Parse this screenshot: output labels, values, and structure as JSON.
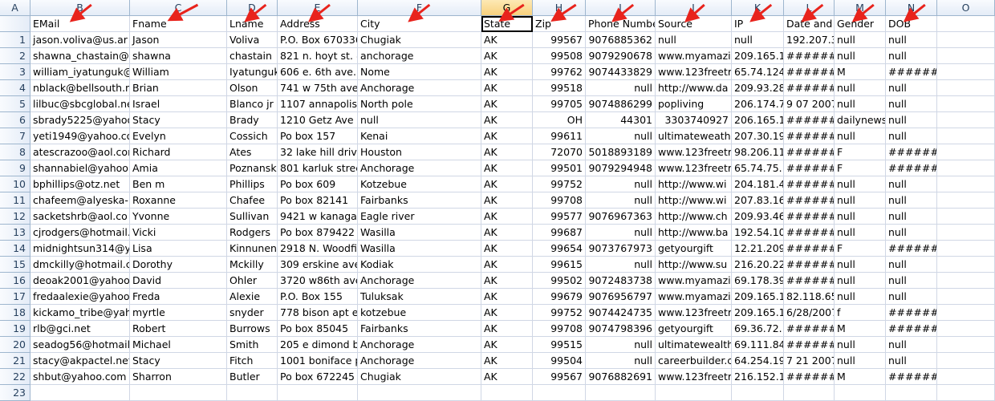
{
  "columns": [
    "A",
    "B",
    "C",
    "D",
    "E",
    "F",
    "G",
    "H",
    "I",
    "J",
    "K",
    "L",
    "M",
    "N",
    "O"
  ],
  "selected_column": "G",
  "accent_color": "#e8231c",
  "rows": [
    [
      "",
      "EMail",
      "Fname",
      "Lname",
      "Address",
      "City",
      "State",
      "Zip",
      "Phone Numbe",
      "Source",
      "IP",
      "Date and",
      "Gender",
      "DOB",
      ""
    ],
    [
      "1",
      "jason.voliva@us.ar",
      "Jason",
      "Voliva",
      "P.O. Box 670336",
      "Chugiak",
      "AK",
      "99567",
      "9076885362",
      "null",
      "null",
      "192.207.30",
      "null",
      "null",
      ""
    ],
    [
      "2",
      "shawna_chastain@",
      "shawna",
      "chastain",
      "821 n. hoyt st. #",
      "anchorage",
      "AK",
      "99508",
      "9079290678",
      "www.myamazi",
      "209.165.17",
      "########",
      "null",
      "null",
      ""
    ],
    [
      "3",
      "william_iyatunguk@",
      "William",
      "Iyatunguk",
      "606 e. 6th ave.",
      "Nome",
      "AK",
      "99762",
      "9074433829",
      "www.123freetr",
      "65.74.124.",
      "########",
      "M",
      "########",
      ""
    ],
    [
      "4",
      "nblack@bellsouth.n",
      "Brian",
      "Olson",
      "741 w 75th ave a",
      "Anchorage",
      "AK",
      "99518",
      "null",
      "http://www.da",
      "209.93.28.",
      "########",
      "null",
      "null",
      ""
    ],
    [
      "5",
      "lilbuc@sbcglobal.ne",
      "Israel",
      "Blanco jr",
      "1107 annapolis",
      "North pole",
      "AK",
      "99705",
      "9074886299",
      "popliving",
      "206.174.7.",
      "9 07 2007 :",
      "null",
      "null",
      ""
    ],
    [
      "6",
      "sbrady5225@yahoo",
      "Stacy",
      "Brady",
      "1210 Getz Ave",
      "null",
      "AK",
      "OH",
      "44301",
      "3303740927",
      "206.165.11",
      "########",
      "dailynews",
      "null",
      ""
    ],
    [
      "7",
      "yeti1949@yahoo.co",
      "Evelyn",
      "Cossich",
      "Po box 157",
      "Kenai",
      "AK",
      "99611",
      "null",
      "ultimateweath",
      "207.30.196",
      "########",
      "null",
      "null",
      ""
    ],
    [
      "8",
      "atescrazoo@aol.cor",
      "Richard",
      "Ates",
      "32 lake hill drive",
      "Houston",
      "AK",
      "72070",
      "5018893189",
      "www.123freetr",
      "98.206.113",
      "########",
      "F",
      "########",
      ""
    ],
    [
      "9",
      "shannabiel@yahoo",
      "Amia",
      "Poznanski",
      "801 karluk stree",
      "Anchorage",
      "AK",
      "99501",
      "9079294948",
      "www.123freetr",
      "65.74.75.1",
      "########",
      "F",
      "########",
      ""
    ],
    [
      "10",
      "bphillips@otz.net",
      "Ben m",
      "Phillips",
      "Po box 609",
      "Kotzebue",
      "AK",
      "99752",
      "null",
      "http://www.wi",
      "204.181.43",
      "########",
      "null",
      "null",
      ""
    ],
    [
      "11",
      "chafeem@alyeska-p",
      "Roxanne",
      "Chafee",
      "Po box 82141",
      "Fairbanks",
      "AK",
      "99708",
      "null",
      "http://www.wi",
      "207.83.16.",
      "########",
      "null",
      "null",
      ""
    ],
    [
      "12",
      "sacketshrb@aol.co",
      "Yvonne",
      "Sullivan",
      "9421 w kanaga l",
      "Eagle river",
      "AK",
      "99577",
      "9076967363",
      "http://www.ch",
      "209.93.46.",
      "########",
      "null",
      "null",
      ""
    ],
    [
      "13",
      "cjrodgers@hotmail.",
      "Vicki",
      "Rodgers",
      "Po box 879422",
      "Wasilla",
      "AK",
      "99687",
      "null",
      "http://www.ba",
      "192.54.109",
      "########",
      "null",
      "null",
      ""
    ],
    [
      "14",
      "midnightsun314@y",
      "Lisa",
      "Kinnunen",
      "2918 N. Woodfie",
      "Wasilla",
      "AK",
      "99654",
      "9073767973",
      "getyourgift",
      "12.21.209.",
      "########",
      "F",
      "########",
      ""
    ],
    [
      "15",
      "dmckilly@hotmail.c",
      "Dorothy",
      "Mckilly",
      "309 erskine ave",
      "Kodiak",
      "AK",
      "99615",
      "null",
      "http://www.su",
      "216.20.221",
      "########",
      "null",
      "null",
      ""
    ],
    [
      "16",
      "deoak2001@yahoo.",
      "David",
      "Ohler",
      "3720 w86th ave",
      "Anchorage",
      "AK",
      "99502",
      "9072483738",
      "www.myamazi",
      "69.178.39.",
      "########",
      "null",
      "null",
      ""
    ],
    [
      "17",
      "fredaalexie@yahoo",
      "Freda",
      "Alexie",
      "P.O. Box 155",
      "Tuluksak",
      "AK",
      "99679",
      "9076956797",
      "www.myamazi",
      "209.165.13",
      "82.118.65.",
      "null",
      "null",
      ""
    ],
    [
      "18",
      "kickamo_tribe@yah",
      "myrtle",
      "snyder",
      "778 bison apt e2",
      "kotzebue",
      "AK",
      "99752",
      "9074424735",
      "www.123freetr",
      "209.165.14",
      "6/28/2007",
      "f",
      "########",
      ""
    ],
    [
      "19",
      "rlb@gci.net",
      "Robert",
      "Burrows",
      "Po box 85045",
      "Fairbanks",
      "AK",
      "99708",
      "9074798396",
      "getyourgift",
      "69.36.72.1",
      "########",
      "M",
      "########",
      ""
    ],
    [
      "20",
      "seadog56@hotmail",
      "Michael",
      "Smith",
      "205 e dimond bl",
      "Anchorage",
      "AK",
      "99515",
      "null",
      "ultimatewealth",
      "69.111.84.",
      "########",
      "null",
      "null",
      ""
    ],
    [
      "21",
      "stacy@akpactel.net",
      "Stacy",
      "Fitch",
      "1001 boniface p",
      "Anchorage",
      "AK",
      "99504",
      "null",
      "careerbuilder.c",
      "64.254.192",
      "7 21 2007 2",
      "null",
      "null",
      ""
    ],
    [
      "22",
      "shbut@yahoo.com",
      "Sharron",
      "Butler",
      "Po box 672245",
      "Chugiak",
      "AK",
      "99567",
      "9076882691",
      "www.123freetr",
      "216.152.17",
      "########",
      "M",
      "########",
      ""
    ],
    [
      "23",
      "",
      "",
      "",
      "",
      "",
      "",
      "",
      "",
      "",
      "",
      "",
      "",
      "",
      ""
    ]
  ]
}
